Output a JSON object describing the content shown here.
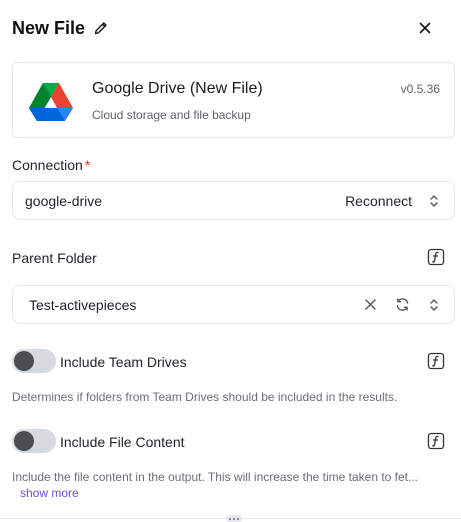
{
  "header": {
    "title": "New File"
  },
  "piece_card": {
    "name": "Google Drive (New File)",
    "description": "Cloud storage and file backup",
    "version": "v0.5.36",
    "logo_colors": [
      "#0066DA",
      "#00AC47",
      "#EA4335",
      "#00832D",
      "#2684FC",
      "#FFBA00"
    ]
  },
  "connection": {
    "label": "Connection",
    "required_mark": "*",
    "value": "google-drive",
    "reconnect_label": "Reconnect"
  },
  "parent_folder": {
    "label": "Parent Folder",
    "value": "Test-activepieces"
  },
  "include_team_drives": {
    "label": "Include Team Drives",
    "enabled": false,
    "description": "Determines if folders from Team Drives should be included in the results."
  },
  "include_file_content": {
    "label": "Include File Content",
    "enabled": false,
    "description": "Include the file content in the output. This will increase the time taken to fet...",
    "show_more_label": "show more"
  },
  "colors": {
    "accent": "#6e4bd6",
    "required": "#d93025",
    "toggle_off_track": "#d6d9de",
    "toggle_knob": "#4a4d52"
  }
}
